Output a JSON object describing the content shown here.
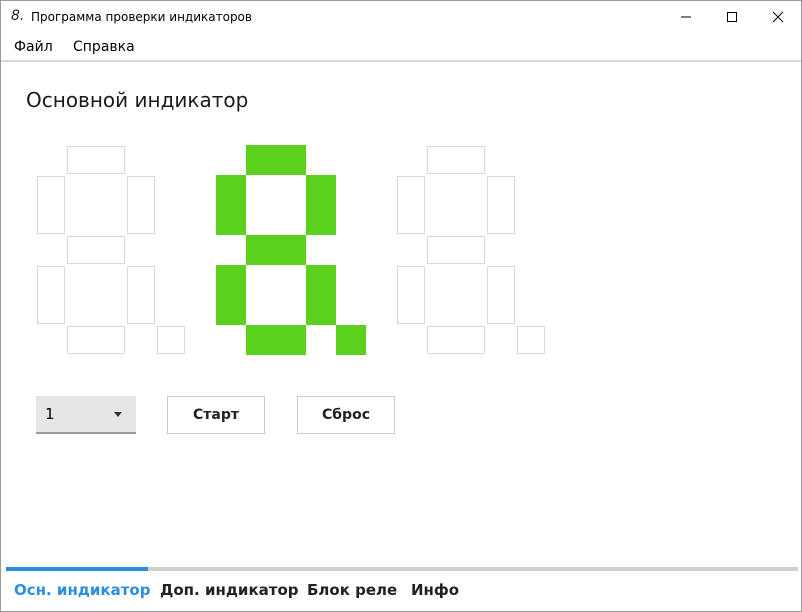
{
  "window": {
    "title": "Программа проверки индикаторов",
    "icon_glyph": "8.",
    "icon": "seven-segment-app-icon",
    "controls": {
      "minimize": "minimize-icon",
      "maximize": "maximize-icon",
      "close": "close-icon"
    }
  },
  "menu": {
    "file": "Файл",
    "help": "Справка"
  },
  "main": {
    "title": "Основной индикатор",
    "accent_color": "#5bd11e",
    "digits": [
      {
        "segments_on": [],
        "dp_on": false
      },
      {
        "segments_on": [
          "a",
          "b",
          "c",
          "d",
          "e",
          "f",
          "g"
        ],
        "dp_on": true
      },
      {
        "segments_on": [],
        "dp_on": false
      }
    ]
  },
  "controls": {
    "select_value": "1",
    "start_label": "Старт",
    "reset_label": "Сброс"
  },
  "tabs": {
    "active_color": "#2b8ee0",
    "items": [
      {
        "label": "Осн. индикатор",
        "active": true
      },
      {
        "label": "Доп. индикатор",
        "active": false
      },
      {
        "label": "Блок реле",
        "active": false
      },
      {
        "label": "Инфо",
        "active": false
      }
    ]
  }
}
